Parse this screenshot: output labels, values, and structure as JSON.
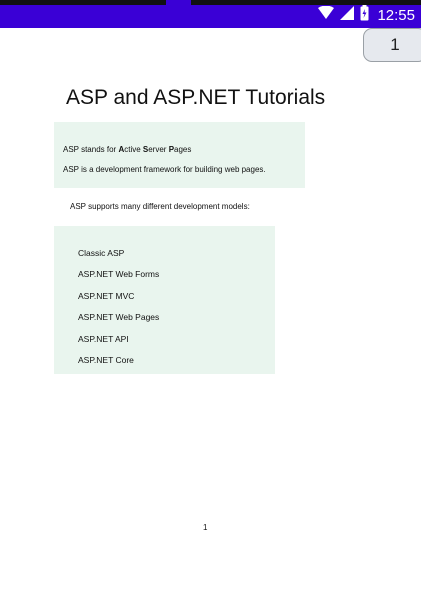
{
  "status_bar": {
    "time": "12:55",
    "icons": [
      "wifi-icon",
      "signal-icon",
      "battery-icon"
    ]
  },
  "page_indicator": {
    "label": "1"
  },
  "document": {
    "title": "ASP and ASP.NET Tutorials",
    "intro": {
      "line1_parts": [
        "ASP stands for ",
        "A",
        "ctive ",
        "S",
        "erver ",
        "P",
        "ages"
      ],
      "line2": "ASP is a development framework for building web pages."
    },
    "models_intro": "ASP supports many different development models:",
    "models": [
      "Classic ASP",
      "ASP.NET Web Forms",
      "ASP.NET MVC",
      "ASP.NET Web Pages",
      "ASP.NET API",
      "ASP.NET Core"
    ],
    "page_number": "1"
  },
  "colors": {
    "status_bar": "#3a00d6",
    "highlight_box": "#e9f5ee",
    "page_button_bg": "#e6e9ee"
  }
}
